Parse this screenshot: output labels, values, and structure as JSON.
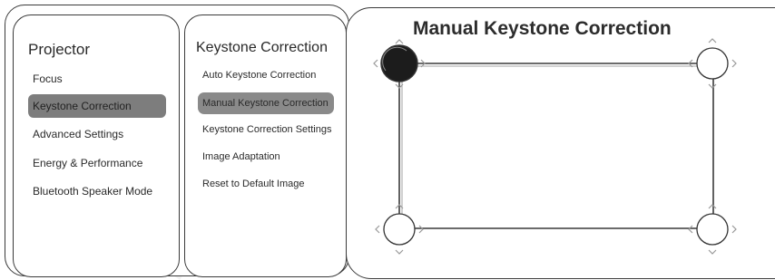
{
  "menu": {
    "title": "Projector",
    "items": [
      {
        "label": "Focus",
        "selected": false
      },
      {
        "label": "Keystone Correction",
        "selected": true
      },
      {
        "label": "Advanced Settings",
        "selected": false
      },
      {
        "label": "Energy & Performance",
        "selected": false
      },
      {
        "label": "Bluetooth Speaker Mode",
        "selected": false
      }
    ]
  },
  "submenu": {
    "title": "Keystone Correction",
    "items": [
      {
        "label": "Auto Keystone Correction",
        "selected": false
      },
      {
        "label": "Manual Keystone Correction",
        "selected": true
      },
      {
        "label": "Keystone Correction Settings",
        "selected": false
      },
      {
        "label": "Image Adaptation",
        "selected": false
      },
      {
        "label": "Reset to Default Image",
        "selected": false
      }
    ]
  },
  "keystone": {
    "title": "Manual Keystone Correction",
    "active_corner": "top-left",
    "corners": [
      "top-left",
      "top-right",
      "bottom-left",
      "bottom-right"
    ]
  },
  "colors": {
    "accent_selected": "#7d7d7d",
    "active_handle": "#1a1a1a",
    "border": "#3a3a3a"
  }
}
